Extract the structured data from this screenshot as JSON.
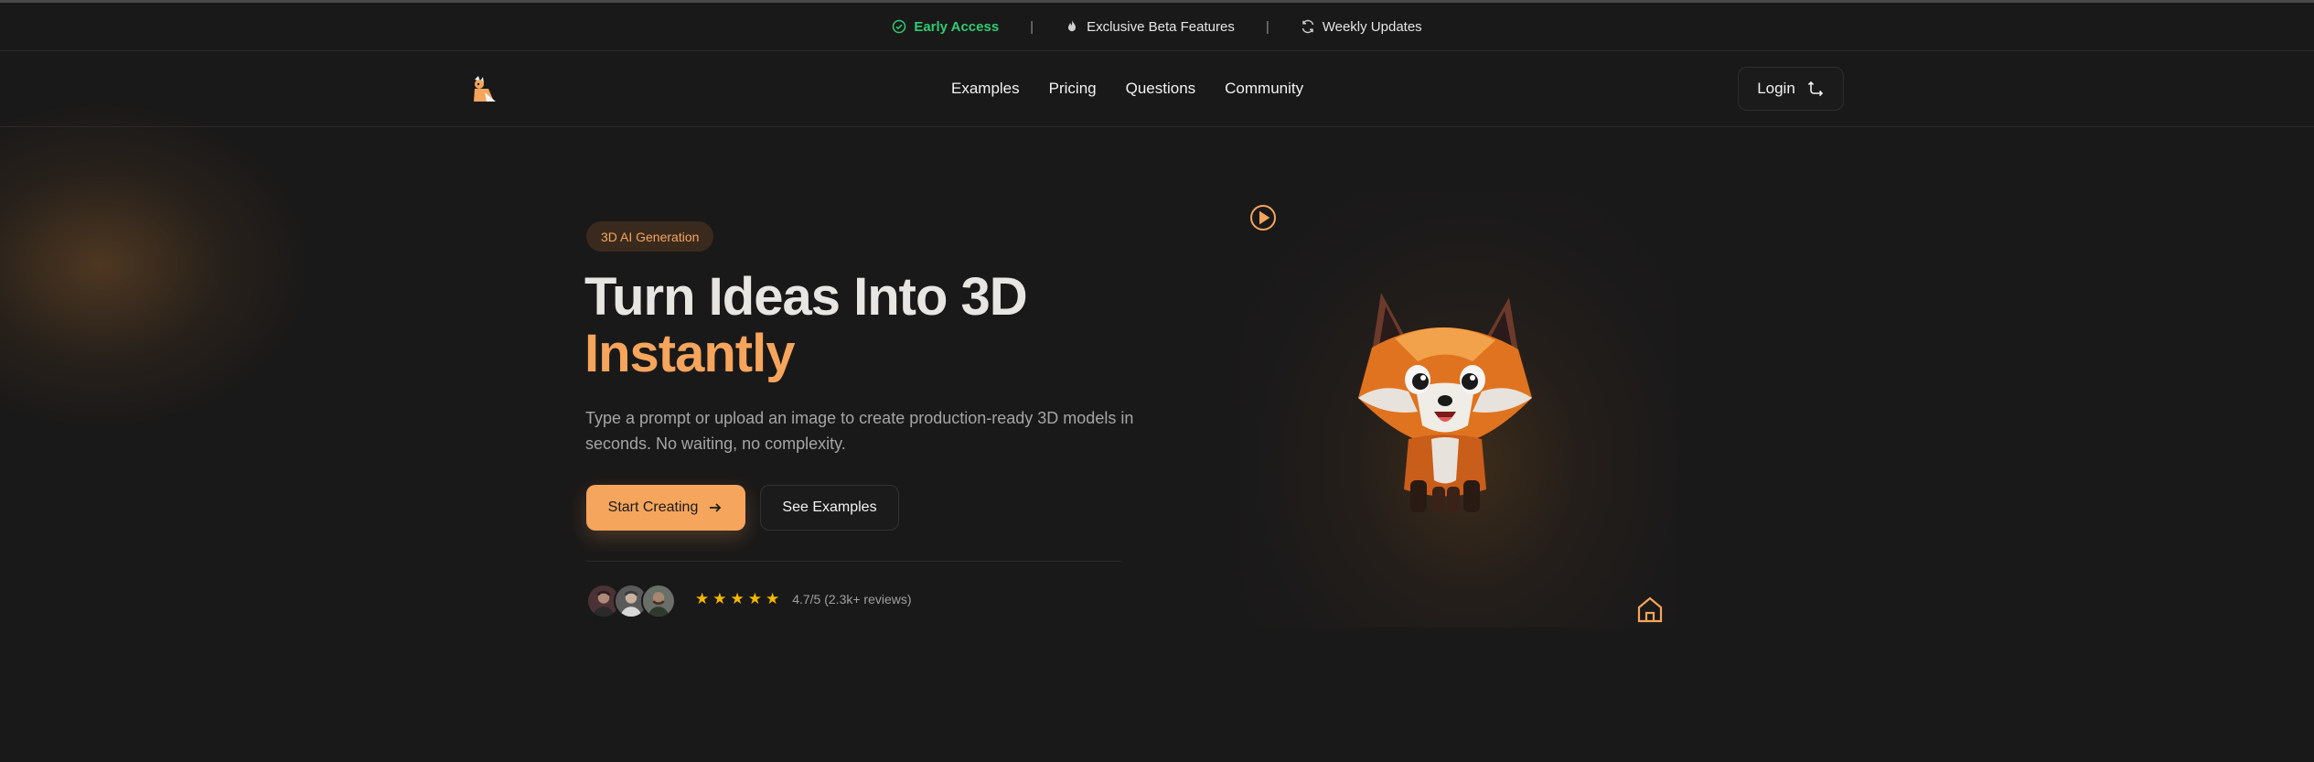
{
  "announcement": {
    "early_access": "Early Access",
    "separator": "|",
    "beta": "Exclusive Beta Features",
    "updates": "Weekly Updates"
  },
  "nav": {
    "links": [
      "Examples",
      "Pricing",
      "Questions",
      "Community"
    ],
    "login": "Login"
  },
  "hero": {
    "badge": "3D AI Generation",
    "title_line1": "Turn Ideas Into 3D",
    "title_line2": "Instantly",
    "subtitle": "Type a prompt or upload an image to create production-ready 3D models in seconds. No waiting, no complexity.",
    "primary_button": "Start Creating",
    "secondary_button": "See Examples",
    "stars": "★★★★★",
    "rating": "4.7/5 (2.3k+ reviews)"
  },
  "colors": {
    "accent": "#f6a55c",
    "success": "#2ecc71",
    "star": "#f5b800",
    "background": "#1a1919"
  },
  "icons": [
    "check-circle-icon",
    "flame-icon",
    "refresh-icon",
    "fox-logo-icon",
    "login-icon",
    "arrow-right-icon",
    "play-icon",
    "home-icon"
  ]
}
